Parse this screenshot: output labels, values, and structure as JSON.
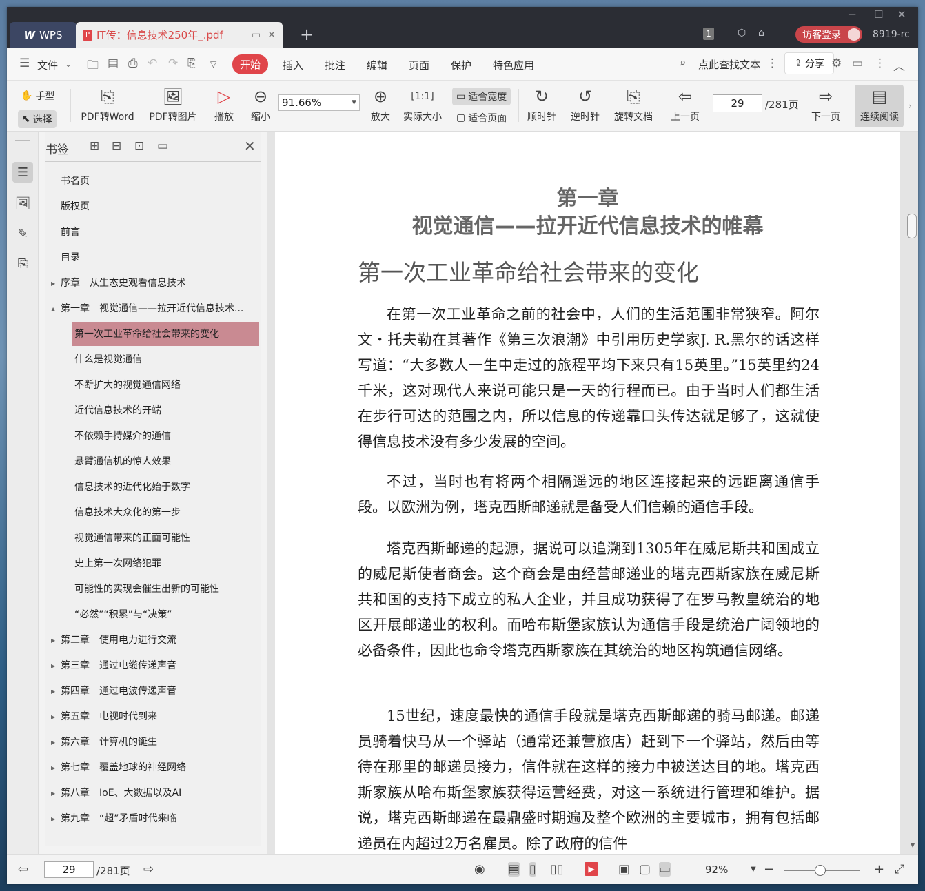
{
  "titlebar": {
    "app_tab": "WPS",
    "doc_tab": "IT传：信息技术250年_.pdf",
    "page_count_badge": "1",
    "login_button": "访客登录",
    "user_id": "8919-rc"
  },
  "menu": {
    "file": "文件",
    "tabs": [
      "开始",
      "插入",
      "批注",
      "编辑",
      "页面",
      "保护",
      "特色应用"
    ],
    "search": "点此查找文本",
    "share": "分享"
  },
  "toolbar": {
    "hand": "手型",
    "select": "选择",
    "pdf_to_word": "PDF转Word",
    "pdf_to_image": "PDF转图片",
    "play": "播放",
    "zoom_out": "缩小",
    "zoom_value": "91.66%",
    "zoom_in": "放大",
    "actual_size": "实际大小",
    "fit_width": "适合宽度",
    "fit_page": "适合页面",
    "clockwise": "顺时针",
    "counterclockwise": "逆时针",
    "rotate_doc": "旋转文档",
    "prev_page": "上一页",
    "current_page": "29",
    "total_pages": "/281页",
    "next_page": "下一页",
    "continuous": "连续阅读"
  },
  "bookmarks": {
    "title": "书签",
    "items": [
      {
        "label": "书名页",
        "level": 0,
        "arrow": ""
      },
      {
        "label": "版权页",
        "level": 0,
        "arrow": ""
      },
      {
        "label": "前言",
        "level": 0,
        "arrow": ""
      },
      {
        "label": "目录",
        "level": 0,
        "arrow": ""
      },
      {
        "label": "序章　从生态史观看信息技术",
        "level": 0,
        "arrow": "▶"
      },
      {
        "label": "第一章　视觉通信——拉开近代信息技术...",
        "level": 0,
        "arrow": "▲"
      },
      {
        "label": "第一次工业革命给社会带来的变化",
        "level": 1,
        "arrow": ""
      },
      {
        "label": "什么是视觉通信",
        "level": 1,
        "arrow": ""
      },
      {
        "label": "不断扩大的视觉通信网络",
        "level": 1,
        "arrow": ""
      },
      {
        "label": "近代信息技术的开端",
        "level": 1,
        "arrow": ""
      },
      {
        "label": "不依赖手持媒介的通信",
        "level": 1,
        "arrow": ""
      },
      {
        "label": "悬臂通信机的惊人效果",
        "level": 1,
        "arrow": ""
      },
      {
        "label": "信息技术的近代化始于数字",
        "level": 1,
        "arrow": ""
      },
      {
        "label": "信息技术大众化的第一步",
        "level": 1,
        "arrow": ""
      },
      {
        "label": "视觉通信带来的正面可能性",
        "level": 1,
        "arrow": ""
      },
      {
        "label": "史上第一次网络犯罪",
        "level": 1,
        "arrow": ""
      },
      {
        "label": "可能性的实现会催生出新的可能性",
        "level": 1,
        "arrow": ""
      },
      {
        "label": "“必然”“积累”与“决策”",
        "level": 1,
        "arrow": ""
      },
      {
        "label": "第二章　使用电力进行交流",
        "level": 0,
        "arrow": "▶"
      },
      {
        "label": "第三章　通过电缆传递声音",
        "level": 0,
        "arrow": "▶"
      },
      {
        "label": "第四章　通过电波传递声音",
        "level": 0,
        "arrow": "▶"
      },
      {
        "label": "第五章　电视时代到来",
        "level": 0,
        "arrow": "▶"
      },
      {
        "label": "第六章　计算机的诞生",
        "level": 0,
        "arrow": "▶"
      },
      {
        "label": "第七章　覆盖地球的神经网络",
        "level": 0,
        "arrow": "▶"
      },
      {
        "label": "第八章　IoE、大数据以及AI",
        "level": 0,
        "arrow": "▶"
      },
      {
        "label": "第九章　“超”矛盾时代来临",
        "level": 0,
        "arrow": "▶"
      }
    ]
  },
  "document": {
    "chapter": "第一章",
    "chapter_title": "视觉通信——拉开近代信息技术的帷幕",
    "section": "第一次工业革命给社会带来的变化",
    "paragraphs": [
      "在第一次工业革命之前的社会中，人们的生活范围非常狭窄。阿尔文・托夫勒在其著作《第三次浪潮》中引用历史学家J. R.黑尔的话这样写道：“大多数人一生中走过的旅程平均下来只有15英里。”15英里约24千米，这对现代人来说可能只是一天的行程而已。由于当时人们都生活在步行可达的范围之内，所以信息的传递靠口头传达就足够了，这就使得信息技术没有多少发展的空间。",
      "不过，当时也有将两个相隔遥远的地区连接起来的远距离通信手段。以欧洲为例，塔克西斯邮递就是备受人们信赖的通信手段。",
      "塔克西斯邮递的起源，据说可以追溯到1305年在威尼斯共和国成立的威尼斯使者商会。这个商会是由经营邮递业的塔克西斯家族在威尼斯共和国的支持下成立的私人企业，并且成功获得了在罗马教皇统治的地区开展邮递业的权利。而哈布斯堡家族认为通信手段是统治广阔领地的必备条件，因此也命令塔克西斯家族在其统治的地区构筑通信网络。",
      "15世纪，速度最快的通信手段就是塔克西斯邮递的骑马邮递。邮递员骑着快马从一个驿站（通常还兼营旅店）赶到下一个驿站，然后由等待在那里的邮递员接力，信件就在这样的接力中被送达目的地。塔克西斯家族从哈布斯堡家族获得运营经费，对这一系统进行管理和维护。据说，塔克西斯邮递在最鼎盛时期遍及整个欧洲的主要城市，拥有包括邮递员在内超过2万名雇员。除了政府的信件"
    ]
  },
  "statusbar": {
    "page": "29",
    "total": "/281页",
    "zoom": "92%"
  }
}
